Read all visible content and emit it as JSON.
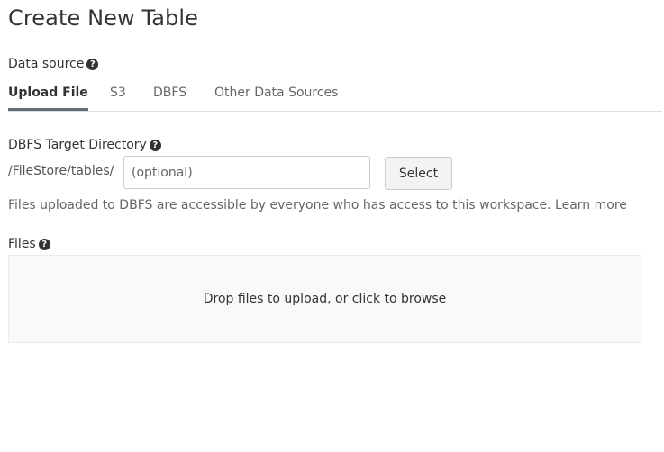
{
  "page": {
    "title": "Create New Table"
  },
  "data_source": {
    "label": "Data source",
    "help_icon": "question-circle-icon",
    "tabs": [
      {
        "label": "Upload File",
        "active": true
      },
      {
        "label": "S3",
        "active": false
      },
      {
        "label": "DBFS",
        "active": false
      },
      {
        "label": "Other Data Sources",
        "active": false
      }
    ]
  },
  "target_directory": {
    "label": "DBFS Target Directory",
    "help_icon": "question-circle-icon",
    "path_prefix": "/FileStore/tables/",
    "input_value": "",
    "input_placeholder": "(optional)",
    "select_label": "Select"
  },
  "info": {
    "text": "Files uploaded to DBFS are accessible by everyone who has access to this workspace.",
    "learn_more": "Learn more"
  },
  "files": {
    "label": "Files",
    "help_icon": "question-circle-icon",
    "dropzone_text": "Drop files to upload, or click to browse"
  },
  "colors": {
    "text": "#333333",
    "muted": "#666666",
    "active_tab_underline": "#666f78",
    "dropzone_bg": "#f9f9f9"
  }
}
